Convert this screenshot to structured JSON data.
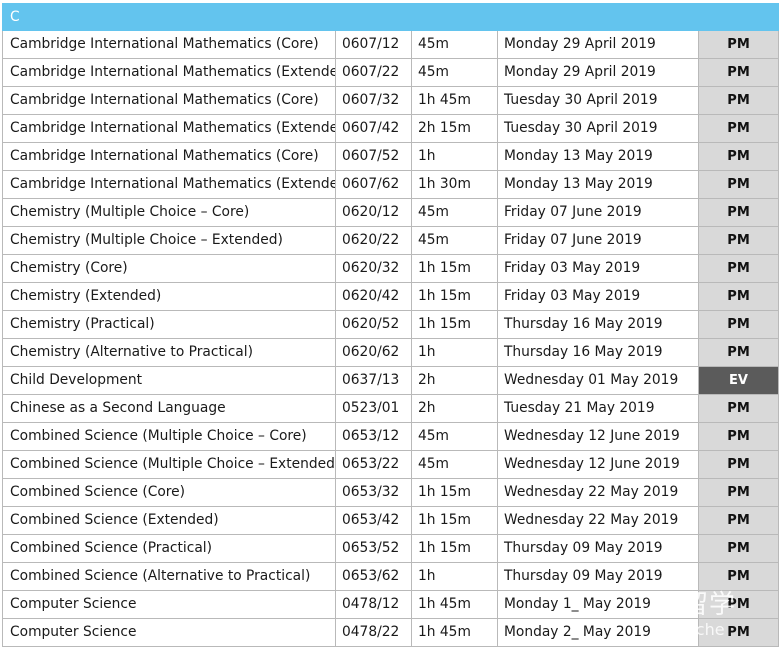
{
  "section": "C",
  "rows": [
    {
      "subject": "Cambridge International Mathematics (Core)",
      "code": "0607/12",
      "duration": "45m",
      "date": "Monday 29 April 2019",
      "session": "PM"
    },
    {
      "subject": "Cambridge International Mathematics (Extended)",
      "code": "0607/22",
      "duration": "45m",
      "date": "Monday 29 April 2019",
      "session": "PM"
    },
    {
      "subject": "Cambridge International Mathematics (Core)",
      "code": "0607/32",
      "duration": "1h 45m",
      "date": "Tuesday 30 April 2019",
      "session": "PM"
    },
    {
      "subject": "Cambridge International Mathematics (Extended)",
      "code": "0607/42",
      "duration": "2h 15m",
      "date": "Tuesday 30 April 2019",
      "session": "PM"
    },
    {
      "subject": "Cambridge International Mathematics (Core)",
      "code": "0607/52",
      "duration": "1h",
      "date": "Monday 13 May 2019",
      "session": "PM"
    },
    {
      "subject": "Cambridge International Mathematics (Extended)",
      "code": "0607/62",
      "duration": "1h 30m",
      "date": "Monday 13 May 2019",
      "session": "PM"
    },
    {
      "subject": "Chemistry (Multiple Choice – Core)",
      "code": "0620/12",
      "duration": "45m",
      "date": "Friday 07 June 2019",
      "session": "PM"
    },
    {
      "subject": "Chemistry (Multiple Choice – Extended)",
      "code": "0620/22",
      "duration": "45m",
      "date": "Friday 07 June 2019",
      "session": "PM"
    },
    {
      "subject": "Chemistry (Core)",
      "code": "0620/32",
      "duration": "1h 15m",
      "date": "Friday 03 May 2019",
      "session": "PM"
    },
    {
      "subject": "Chemistry (Extended)",
      "code": "0620/42",
      "duration": "1h 15m",
      "date": "Friday 03 May 2019",
      "session": "PM"
    },
    {
      "subject": "Chemistry (Practical)",
      "code": "0620/52",
      "duration": "1h 15m",
      "date": "Thursday 16 May 2019",
      "session": "PM"
    },
    {
      "subject": "Chemistry (Alternative to Practical)",
      "code": "0620/62",
      "duration": "1h",
      "date": "Thursday 16 May 2019",
      "session": "PM"
    },
    {
      "subject": "Child Development",
      "code": "0637/13",
      "duration": "2h",
      "date": "Wednesday 01 May 2019",
      "session": "EV"
    },
    {
      "subject": "Chinese as a Second Language",
      "code": "0523/01",
      "duration": "2h",
      "date": "Tuesday 21 May 2019",
      "session": "PM"
    },
    {
      "subject": "Combined Science (Multiple Choice – Core)",
      "code": "0653/12",
      "duration": "45m",
      "date": "Wednesday 12 June 2019",
      "session": "PM"
    },
    {
      "subject": "Combined Science (Multiple Choice – Extended)",
      "code": "0653/22",
      "duration": "45m",
      "date": "Wednesday 12 June 2019",
      "session": "PM"
    },
    {
      "subject": "Combined Science (Core)",
      "code": "0653/32",
      "duration": "1h 15m",
      "date": "Wednesday 22 May 2019",
      "session": "PM"
    },
    {
      "subject": "Combined Science (Extended)",
      "code": "0653/42",
      "duration": "1h 15m",
      "date": "Wednesday 22 May 2019",
      "session": "PM"
    },
    {
      "subject": "Combined Science (Practical)",
      "code": "0653/52",
      "duration": "1h 15m",
      "date": "Thursday 09 May 2019",
      "session": "PM"
    },
    {
      "subject": "Combined Science (Alternative to Practical)",
      "code": "0653/62",
      "duration": "1h",
      "date": "Thursday 09 May 2019",
      "session": "PM"
    },
    {
      "subject": "Computer Science",
      "code": "0478/12",
      "duration": "1h 45m",
      "date": "Monday 1_ May 2019",
      "session": "PM"
    },
    {
      "subject": "Computer Science",
      "code": "0478/22",
      "duration": "1h 45m",
      "date": "Monday 2_ May 2019",
      "session": "PM"
    }
  ],
  "watermark": {
    "text": "留学",
    "sub": "ache"
  },
  "colors": {
    "section_header": "#63c4ee",
    "session_pm": "#d9d9d9",
    "session_ev": "#5b5b5b"
  }
}
